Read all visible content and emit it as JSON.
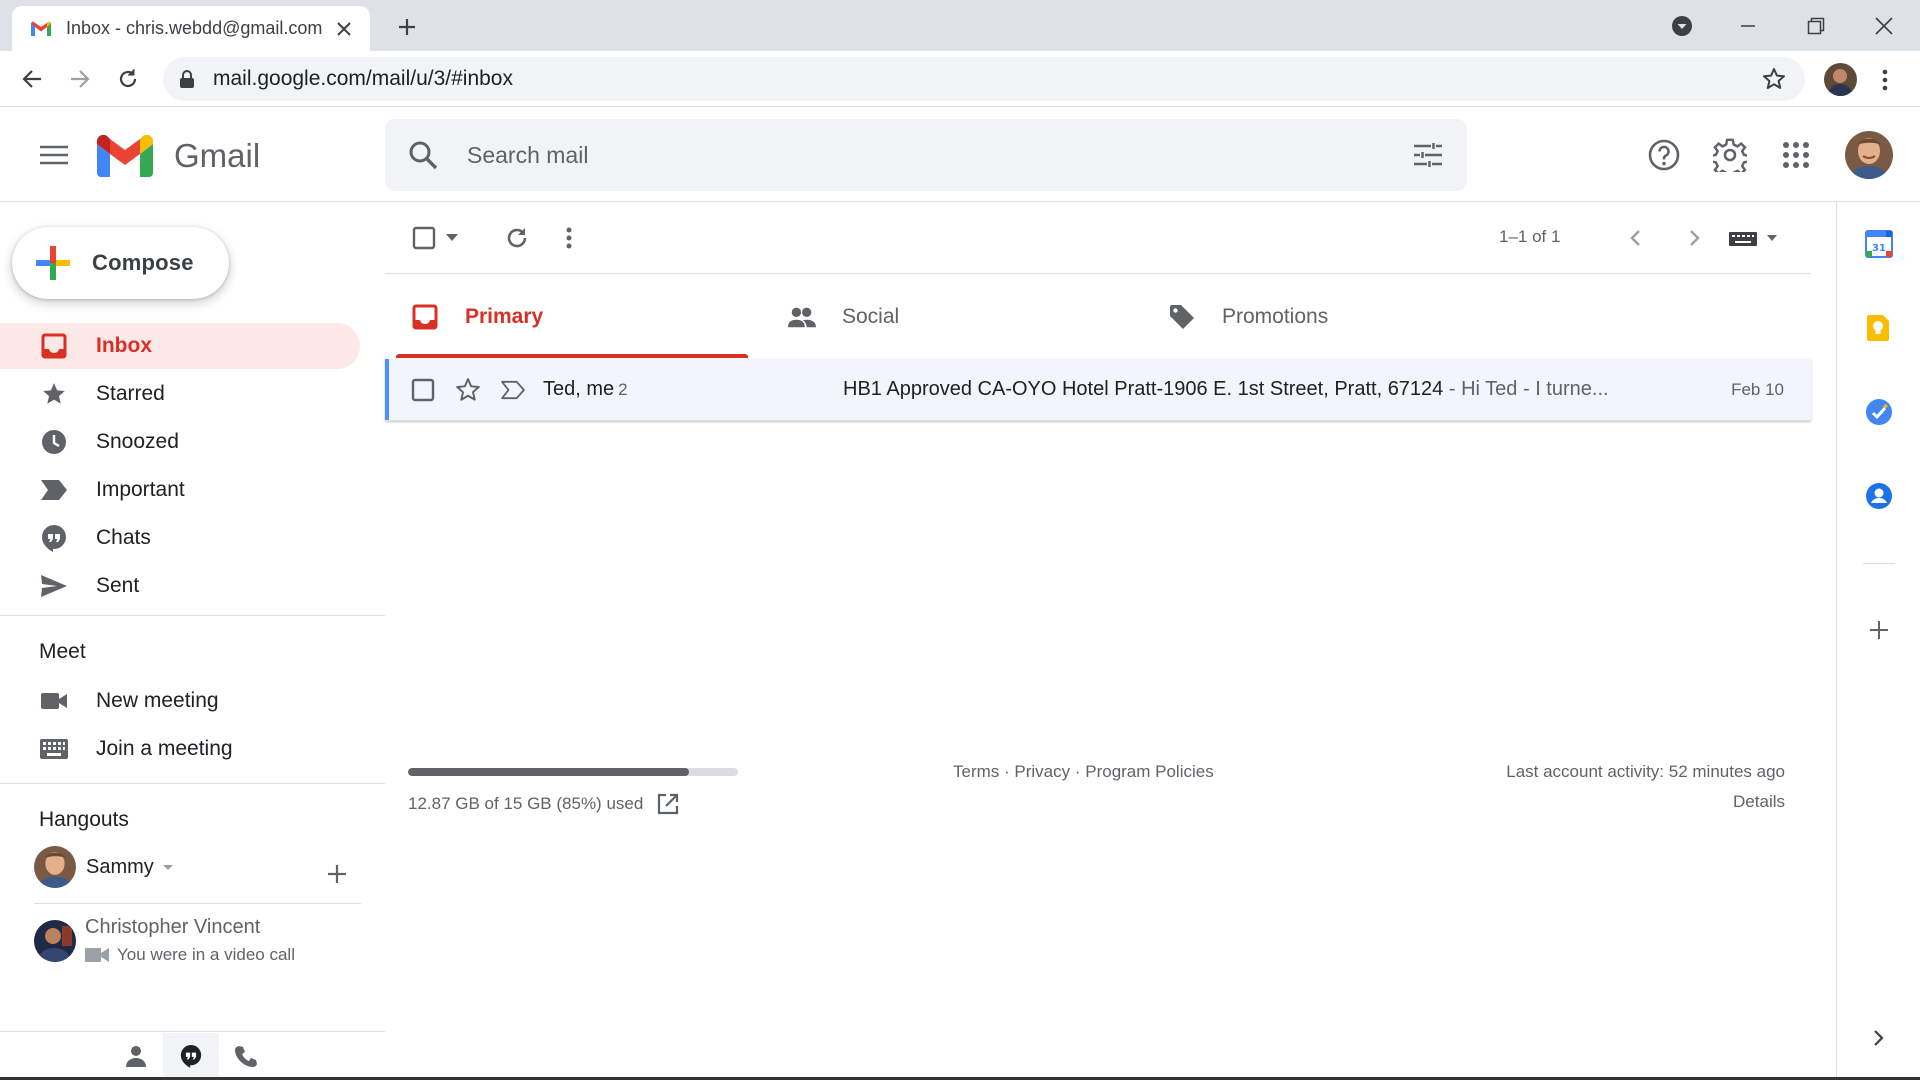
{
  "browser": {
    "tab_title": "Inbox - chris.webdd@gmail.com",
    "url": "mail.google.com/mail/u/3/#inbox"
  },
  "header": {
    "app_name": "Gmail",
    "search_placeholder": "Search mail"
  },
  "compose_label": "Compose",
  "nav": {
    "items": [
      {
        "label": "Inbox",
        "icon": "inbox-icon",
        "active": true
      },
      {
        "label": "Starred",
        "icon": "star-icon"
      },
      {
        "label": "Snoozed",
        "icon": "clock-icon"
      },
      {
        "label": "Important",
        "icon": "important-icon"
      },
      {
        "label": "Chats",
        "icon": "chat-icon"
      },
      {
        "label": "Sent",
        "icon": "send-icon"
      }
    ],
    "meet": {
      "title": "Meet",
      "new_meeting": "New meeting",
      "join_meeting": "Join a meeting"
    },
    "hangouts": {
      "title": "Hangouts",
      "user": "Sammy",
      "contact_name": "Christopher Vincent",
      "contact_status": "You were in a video call"
    }
  },
  "toolbar": {
    "pager": "1–1 of 1"
  },
  "categories": [
    {
      "label": "Primary",
      "icon": "inbox-icon",
      "active": true
    },
    {
      "label": "Social",
      "icon": "people-icon"
    },
    {
      "label": "Promotions",
      "icon": "tag-icon"
    }
  ],
  "emails": [
    {
      "sender": "Ted, me",
      "count": "2",
      "subject": "HB1 Approved CA-OYO Hotel Pratt-1906 E. 1st Street, Pratt, 67124",
      "snippet": " - Hi Ted - I turne...",
      "date": "Feb 10"
    }
  ],
  "footer": {
    "storage_text": "12.87 GB of 15 GB (85%) used",
    "storage_fraction": 0.85,
    "terms": "Terms",
    "sep": " · ",
    "privacy": "Privacy",
    "policies": "Program Policies",
    "last_activity": "Last account activity: 52 minutes ago",
    "details": "Details"
  },
  "colors": {
    "accent_red": "#d93025",
    "active_bg": "#fce8e6",
    "row_highlight": "#4d90fe"
  }
}
